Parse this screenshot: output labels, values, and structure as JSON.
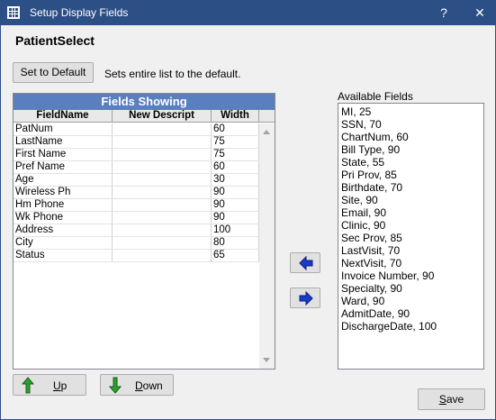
{
  "window": {
    "title": "Setup Display Fields",
    "help_glyph": "?",
    "close_glyph": "✕"
  },
  "heading": "PatientSelect",
  "toolbar": {
    "set_default_label": "Set to Default",
    "hint": "Sets entire list to the default."
  },
  "fields_grid": {
    "title": "Fields Showing",
    "columns": [
      "FieldName",
      "New Descript",
      "Width"
    ],
    "rows": [
      [
        "PatNum",
        "",
        "60"
      ],
      [
        "LastName",
        "",
        "75"
      ],
      [
        "First Name",
        "",
        "75"
      ],
      [
        "Pref Name",
        "",
        "60"
      ],
      [
        "Age",
        "",
        "30"
      ],
      [
        "Wireless Ph",
        "",
        "90"
      ],
      [
        "Hm Phone",
        "",
        "90"
      ],
      [
        "Wk Phone",
        "",
        "90"
      ],
      [
        "Address",
        "",
        "100"
      ],
      [
        "City",
        "",
        "80"
      ],
      [
        "Status",
        "",
        "65"
      ]
    ]
  },
  "available": {
    "label": "Available Fields",
    "items": [
      "MI, 25",
      "SSN, 70",
      "ChartNum, 60",
      "Bill Type, 90",
      "State, 55",
      "Pri Prov, 85",
      "Birthdate, 70",
      "Site, 90",
      "Email, 90",
      "Clinic, 90",
      "Sec Prov, 85",
      "LastVisit, 70",
      "NextVisit, 70",
      "Invoice Number, 90",
      "Specialty, 90",
      "Ward, 90",
      "AdmitDate, 90",
      "DischargeDate, 100"
    ]
  },
  "buttons": {
    "up_first": "U",
    "up_rest": "p",
    "down_first": "D",
    "down_rest": "own",
    "save_first": "S",
    "save_rest": "ave"
  },
  "icons": {
    "app": "grid-app-icon",
    "move_left": "blue-arrow-left-icon",
    "move_right": "blue-arrow-right-icon",
    "up": "green-arrow-up-icon",
    "down": "green-arrow-down-icon"
  },
  "colors": {
    "titlebar": "#2c4f86",
    "grid_title": "#5a7fbf",
    "arrow_blue": "#1a3cc8",
    "arrow_green": "#2e9e2e"
  }
}
